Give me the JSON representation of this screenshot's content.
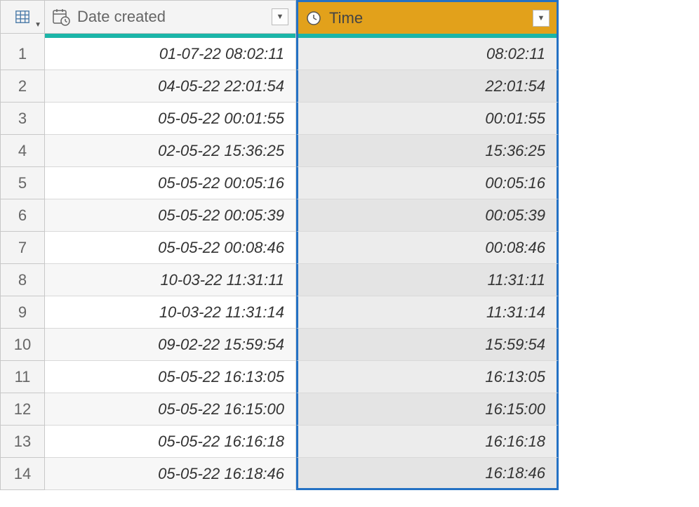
{
  "columns": {
    "date_created": {
      "label": "Date created"
    },
    "time": {
      "label": "Time"
    }
  },
  "rows": [
    {
      "num": "1",
      "date": "01-07-22 08:02:11",
      "time": "08:02:11"
    },
    {
      "num": "2",
      "date": "04-05-22 22:01:54",
      "time": "22:01:54"
    },
    {
      "num": "3",
      "date": "05-05-22 00:01:55",
      "time": "00:01:55"
    },
    {
      "num": "4",
      "date": "02-05-22 15:36:25",
      "time": "15:36:25"
    },
    {
      "num": "5",
      "date": "05-05-22 00:05:16",
      "time": "00:05:16"
    },
    {
      "num": "6",
      "date": "05-05-22 00:05:39",
      "time": "00:05:39"
    },
    {
      "num": "7",
      "date": "05-05-22 00:08:46",
      "time": "00:08:46"
    },
    {
      "num": "8",
      "date": "10-03-22 11:31:11",
      "time": "11:31:11"
    },
    {
      "num": "9",
      "date": "10-03-22 11:31:14",
      "time": "11:31:14"
    },
    {
      "num": "10",
      "date": "09-02-22 15:59:54",
      "time": "15:59:54"
    },
    {
      "num": "11",
      "date": "05-05-22 16:13:05",
      "time": "16:13:05"
    },
    {
      "num": "12",
      "date": "05-05-22 16:15:00",
      "time": "16:15:00"
    },
    {
      "num": "13",
      "date": "05-05-22 16:16:18",
      "time": "16:16:18"
    },
    {
      "num": "14",
      "date": "05-05-22 16:18:46",
      "time": "16:18:46"
    }
  ]
}
